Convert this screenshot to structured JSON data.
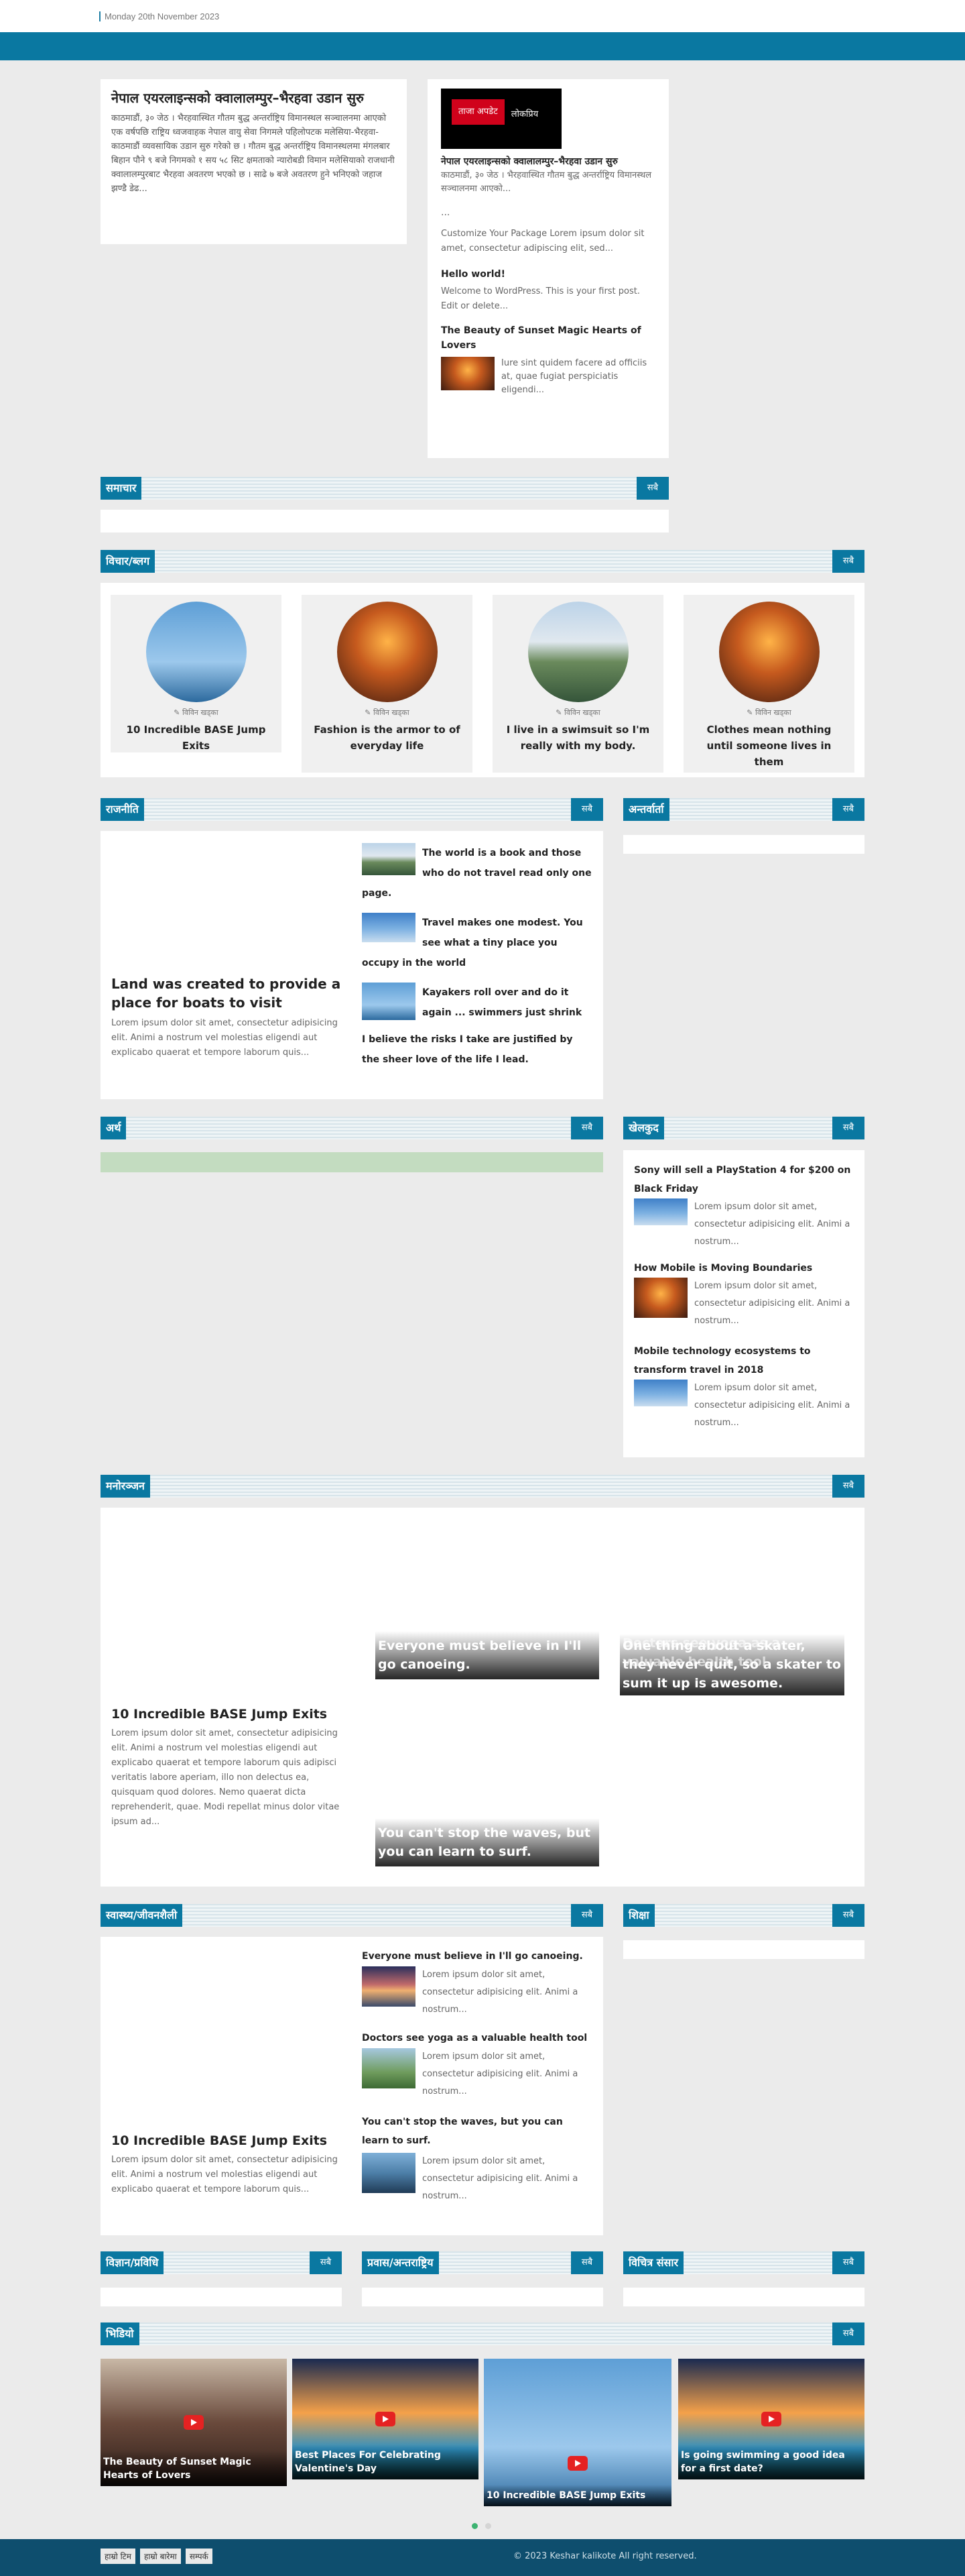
{
  "topbar": {
    "date": "Monday 20th November 2023"
  },
  "lead": {
    "title": "नेपाल एयरलाइन्सको क्वालालम्पुर–भैरहवा उडान सुरु",
    "excerpt": "काठमाडौं, ३० जेठ । भैरहवास्थित गौतम बुद्ध अन्तर्राष्ट्रिय विमानस्थल सञ्चालनमा आएको एक वर्षपछि राष्ट्रिय ध्वजवाहक नेपाल वायु सेवा निगमले पहिलोपटक मलेसिया-भैरहवा-काठमाडौं व्यवसायिक उडान सुरु गरेको छ । गौतम बुद्ध अन्तर्राष्ट्रिय विमानस्थलमा मंगलबार बिहान पौने ९ बजे निगमको १ सय ५८ सिट क्षमताको न्यारोबडी विमान मलेसियाको राजधानी क्वालालम्पुरबाट भैरहवा अवतरण भएको छ । साढे ७ बजे अवतरण हुने भनिएको जहाज झण्डै डेढ..."
  },
  "tabbox": {
    "tabs": [
      "ताजा अपडेट",
      "लोकप्रिय"
    ],
    "items": [
      {
        "title": "नेपाल एयरलाइन्सको क्वालालम्पुर–भैरहवा उडान सुरु",
        "text": "काठमाडौं, ३० जेठ । भैरहवास्थित गौतम बुद्ध अन्तर्राष्ट्रिय विमानस्थल सञ्चालनमा आएको..."
      },
      {
        "title": "...",
        "text": "Customize Your Package Lorem ipsum dolor sit amet, consectetur adipiscing elit, sed..."
      },
      {
        "title": "Hello world!",
        "text": "Welcome to WordPress. This is your first post. Edit or delete..."
      },
      {
        "title": "The Beauty of Sunset Magic Hearts of Lovers",
        "text": "Iure sint quidem facere ad officiis at, quae fugiat perspiciatis eligendi..."
      }
    ]
  },
  "sections": {
    "samachar": {
      "name": "समाचार",
      "more": "सबै"
    },
    "bichar": {
      "name": "विचार/ब्लग",
      "more": "सबै"
    },
    "rajniti": {
      "name": "राजनीति",
      "more": "सबै"
    },
    "antarbarta": {
      "name": "अन्तर्वार्ता",
      "more": "सबै"
    },
    "artha": {
      "name": "अर्थ",
      "more": "सबै"
    },
    "khelkud": {
      "name": "खेलकुद",
      "more": "सबै"
    },
    "manoranjan": {
      "name": "मनोरञ्जन",
      "more": "सबै"
    },
    "swasthya": {
      "name": "स्वास्थ्य/जीवनशैली",
      "more": "सबै"
    },
    "shiksha": {
      "name": "शिक्षा",
      "more": "सबै"
    },
    "bigyan": {
      "name": "विज्ञान/प्रविधि",
      "more": "सबै"
    },
    "prabas": {
      "name": "प्रवास/अन्तराष्ट्रिय",
      "more": "सबै"
    },
    "bichitra": {
      "name": "विचित्र संसार",
      "more": "सबै"
    },
    "video": {
      "name": "भिडियो",
      "more": "सबै"
    }
  },
  "blogs": [
    {
      "author": "विविन खड्का",
      "title": "10 Incredible BASE Jump Exits"
    },
    {
      "author": "विविन खड्का",
      "title": "Fashion is the armor to of everyday life"
    },
    {
      "author": "विविन खड्का",
      "title": "I live in a swimsuit so I'm really with my body."
    },
    {
      "author": "विविन खड्का",
      "title": "Clothes mean nothing until someone lives in them"
    }
  ],
  "rajniti": {
    "main_title": "Land was created to provide a place for boats to visit",
    "main_text": "Lorem ipsum dolor sit amet, consectetur adipisicing elit. Animi a nostrum vel molestias eligendi aut explicabo quaerat et tempore laborum quis...",
    "list": [
      "The world is a book and those who do not travel read only one page.",
      "Travel makes one modest. You see what a tiny place you occupy in the world",
      "Kayakers roll over and do it again ... swimmers just shrink",
      "I believe the risks I take are justified by the sheer love of the life I lead."
    ]
  },
  "khelkud": [
    {
      "title": "Sony will sell a PlayStation 4 for $200 on Black Friday",
      "text": "Lorem ipsum dolor sit amet, consectetur adipisicing elit. Animi a nostrum..."
    },
    {
      "title": "How Mobile is Moving Boundaries",
      "text": "Lorem ipsum dolor sit amet, consectetur adipisicing elit. Animi a nostrum..."
    },
    {
      "title": "Mobile technology ecosystems to transform travel in 2018",
      "text": "Lorem ipsum dolor sit amet, consectetur adipisicing elit. Animi a nostrum..."
    }
  ],
  "manoranjan": {
    "main_title": "10 Incredible BASE Jump Exits",
    "main_text": "Lorem ipsum dolor sit amet, consectetur adipisicing elit. Animi a nostrum vel molestias eligendi aut explicabo quaerat et tempore laborum quis adipisci veritatis labore aperiam, illo non delectus ea, quisquam quod dolores. Nemo quaerat dicta reprehenderit, quae. Modi repellat minus dolor vitae ipsum ad...",
    "tile1": "Everyone must believe in I'll go canoeing.",
    "tile2_ghost": "Doctors see yoga as a valuable health tool",
    "tile2": "One thing about a skater, they never quit, so a skater to sum it up is awesome.",
    "tile3": "You can't stop the waves, but you can learn to surf."
  },
  "swasthya": {
    "main_title": "10 Incredible BASE Jump Exits",
    "main_text": "Lorem ipsum dolor sit amet, consectetur adipisicing elit. Animi a nostrum vel molestias eligendi aut explicabo quaerat et tempore laborum quis...",
    "list": [
      {
        "title": "Everyone must believe in I'll go canoeing.",
        "text": "Lorem ipsum dolor sit amet, consectetur adipisicing elit. Animi a nostrum..."
      },
      {
        "title": "Doctors see yoga as a valuable health tool",
        "text": "Lorem ipsum dolor sit amet, consectetur adipisicing elit. Animi a nostrum..."
      },
      {
        "title": "You can't stop the waves, but you can learn to surf.",
        "text": "Lorem ipsum dolor sit amet, consectetur adipisicing elit. Animi a nostrum..."
      }
    ]
  },
  "videos": [
    "The Beauty of Sunset Magic Hearts of Lovers",
    "Best Places For Celebrating Valentine's Day",
    "10 Incredible BASE Jump Exits",
    "Is going swimming a good idea for a first date?"
  ],
  "footer": {
    "links": [
      "हाम्रो टिम",
      "हाम्रो बारेमा",
      "सम्पर्क"
    ],
    "copyright": "© 2023 Keshar kalikote All right reserved."
  }
}
